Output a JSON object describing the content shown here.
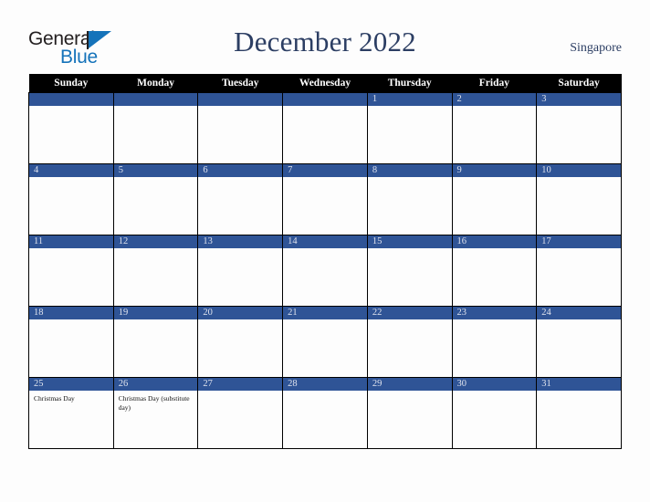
{
  "brand": {
    "word_top": "General",
    "word_bottom": "Blue",
    "triangle_color": "#1573ba",
    "text_color": "#231f20"
  },
  "header": {
    "title": "December 2022",
    "region": "Singapore",
    "title_color": "#2c3e63"
  },
  "calendar": {
    "weekday_headers": [
      "Sunday",
      "Monday",
      "Tuesday",
      "Wednesday",
      "Thursday",
      "Friday",
      "Saturday"
    ],
    "header_bg": "#000000",
    "daynum_band_bg": "#2f5496",
    "daynum_color": "#dfe3ee",
    "weeks": [
      [
        {
          "day": "",
          "events": []
        },
        {
          "day": "",
          "events": []
        },
        {
          "day": "",
          "events": []
        },
        {
          "day": "",
          "events": []
        },
        {
          "day": "1",
          "events": []
        },
        {
          "day": "2",
          "events": []
        },
        {
          "day": "3",
          "events": []
        }
      ],
      [
        {
          "day": "4",
          "events": []
        },
        {
          "day": "5",
          "events": []
        },
        {
          "day": "6",
          "events": []
        },
        {
          "day": "7",
          "events": []
        },
        {
          "day": "8",
          "events": []
        },
        {
          "day": "9",
          "events": []
        },
        {
          "day": "10",
          "events": []
        }
      ],
      [
        {
          "day": "11",
          "events": []
        },
        {
          "day": "12",
          "events": []
        },
        {
          "day": "13",
          "events": []
        },
        {
          "day": "14",
          "events": []
        },
        {
          "day": "15",
          "events": []
        },
        {
          "day": "16",
          "events": []
        },
        {
          "day": "17",
          "events": []
        }
      ],
      [
        {
          "day": "18",
          "events": []
        },
        {
          "day": "19",
          "events": []
        },
        {
          "day": "20",
          "events": []
        },
        {
          "day": "21",
          "events": []
        },
        {
          "day": "22",
          "events": []
        },
        {
          "day": "23",
          "events": []
        },
        {
          "day": "24",
          "events": []
        }
      ],
      [
        {
          "day": "25",
          "events": [
            "Christmas Day"
          ]
        },
        {
          "day": "26",
          "events": [
            "Christmas Day (substitute day)"
          ]
        },
        {
          "day": "27",
          "events": []
        },
        {
          "day": "28",
          "events": []
        },
        {
          "day": "29",
          "events": []
        },
        {
          "day": "30",
          "events": []
        },
        {
          "day": "31",
          "events": []
        }
      ]
    ]
  }
}
